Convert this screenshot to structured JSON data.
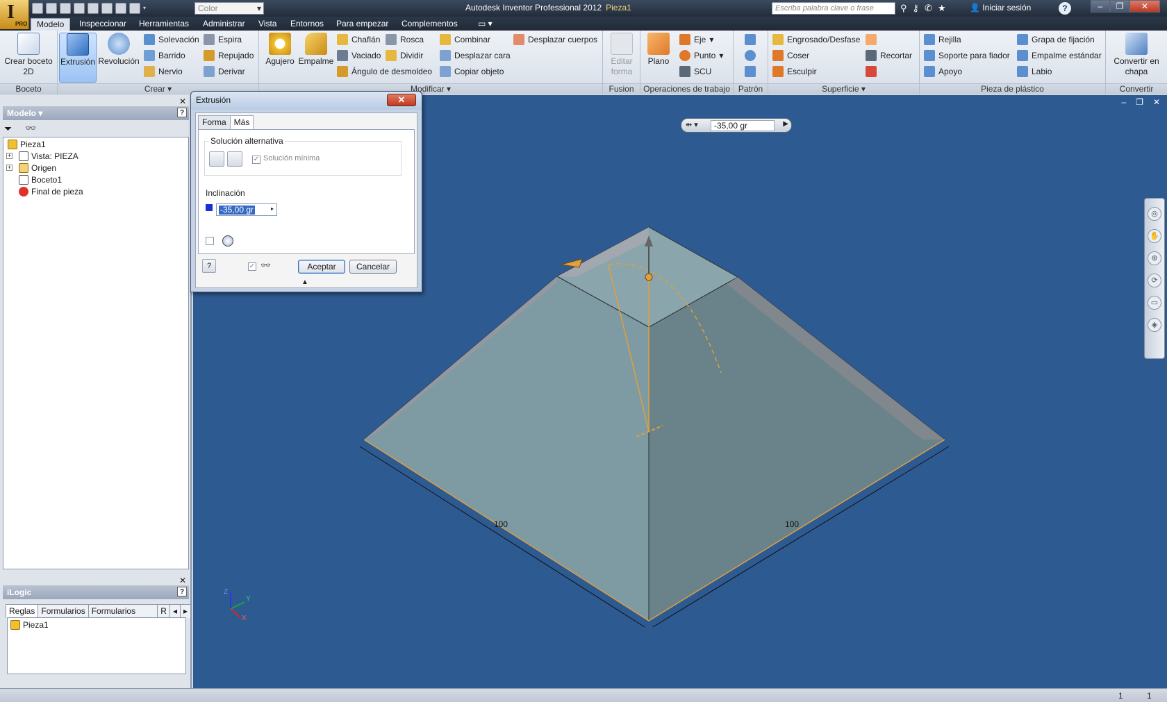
{
  "app": {
    "title": "Autodesk Inventor Professional 2012",
    "document": "Pieza1",
    "logo_letter": "I",
    "logo_badge": "PRO",
    "color_dropdown": "Color",
    "search_placeholder": "Escriba palabra clave o frase",
    "signin": "Iniciar sesión",
    "help": "?"
  },
  "tabs": [
    "Modelo",
    "Inspeccionar",
    "Herramientas",
    "Administrar",
    "Vista",
    "Entornos",
    "Para empezar",
    "Complementos"
  ],
  "ribbon": {
    "boceto": {
      "label": "Boceto",
      "crear_boceto": "Crear boceto 2D"
    },
    "crear": {
      "label": "Crear",
      "extrusion": "Extrusión",
      "revolucion": "Revolución",
      "solevacion": "Solevación",
      "barrido": "Barrido",
      "nervio": "Nervio",
      "espira": "Espira",
      "repujado": "Repujado",
      "derivar": "Derivar"
    },
    "modificar": {
      "label": "Modificar",
      "agujero": "Agujero",
      "empalme": "Empalme",
      "chaflan": "Chaflán",
      "vaciado": "Vaciado",
      "angulo": "Ángulo de desmoldeo",
      "rosca": "Rosca",
      "dividir": "Dividir",
      "combinar": "Combinar",
      "desplazar_cara": "Desplazar cara",
      "copiar_objeto": "Copiar objeto",
      "desplazar_cuerpos": "Desplazar cuerpos"
    },
    "fusion": {
      "label": "Fusion",
      "editar_forma": "Editar forma"
    },
    "operaciones": {
      "label": "Operaciones de trabajo",
      "plano": "Plano",
      "eje": "Eje",
      "punto": "Punto",
      "scu": "SCU"
    },
    "patron": {
      "label": "Patrón"
    },
    "superficie": {
      "label": "Superficie",
      "engrosado": "Engrosado/Desfase",
      "coser": "Coser",
      "esculpir": "Esculpir",
      "recortar": "Recortar"
    },
    "plastico": {
      "label": "Pieza de plástico",
      "rejilla": "Rejilla",
      "soporte": "Soporte para fiador",
      "apoyo": "Apoyo",
      "grapa": "Grapa de fijación",
      "empalme_std": "Empalme estándar",
      "labio": "Labio"
    },
    "convertir": {
      "label": "Convertir",
      "convertir_chapa": "Convertir en chapa"
    }
  },
  "model_panel": {
    "title": "Modelo",
    "tree": [
      "Pieza1",
      "Vista: PIEZA",
      "Origen",
      "Boceto1",
      "Final de pieza"
    ]
  },
  "ilogic": {
    "title": "iLogic",
    "tabs": [
      "Reglas",
      "Formularios",
      "Formularios globales",
      "R"
    ],
    "items": [
      "Pieza1"
    ]
  },
  "dialog": {
    "title": "Extrusión",
    "tabs": [
      "Forma",
      "Más"
    ],
    "alt_solution": "Solución alternativa",
    "min_solution": "Solución mínima",
    "taper_label": "Inclinación",
    "taper_value": "-35,00 gr",
    "accept": "Aceptar",
    "cancel": "Cancelar"
  },
  "viewport": {
    "minitool_value": "-35,00 gr",
    "dim_left": "100",
    "dim_right": "100",
    "axis_z": "Z",
    "axis_y": "Y",
    "axis_x": "X",
    "background": "#2e5a92"
  },
  "status": {
    "left_count": "1",
    "right_count": "1"
  }
}
